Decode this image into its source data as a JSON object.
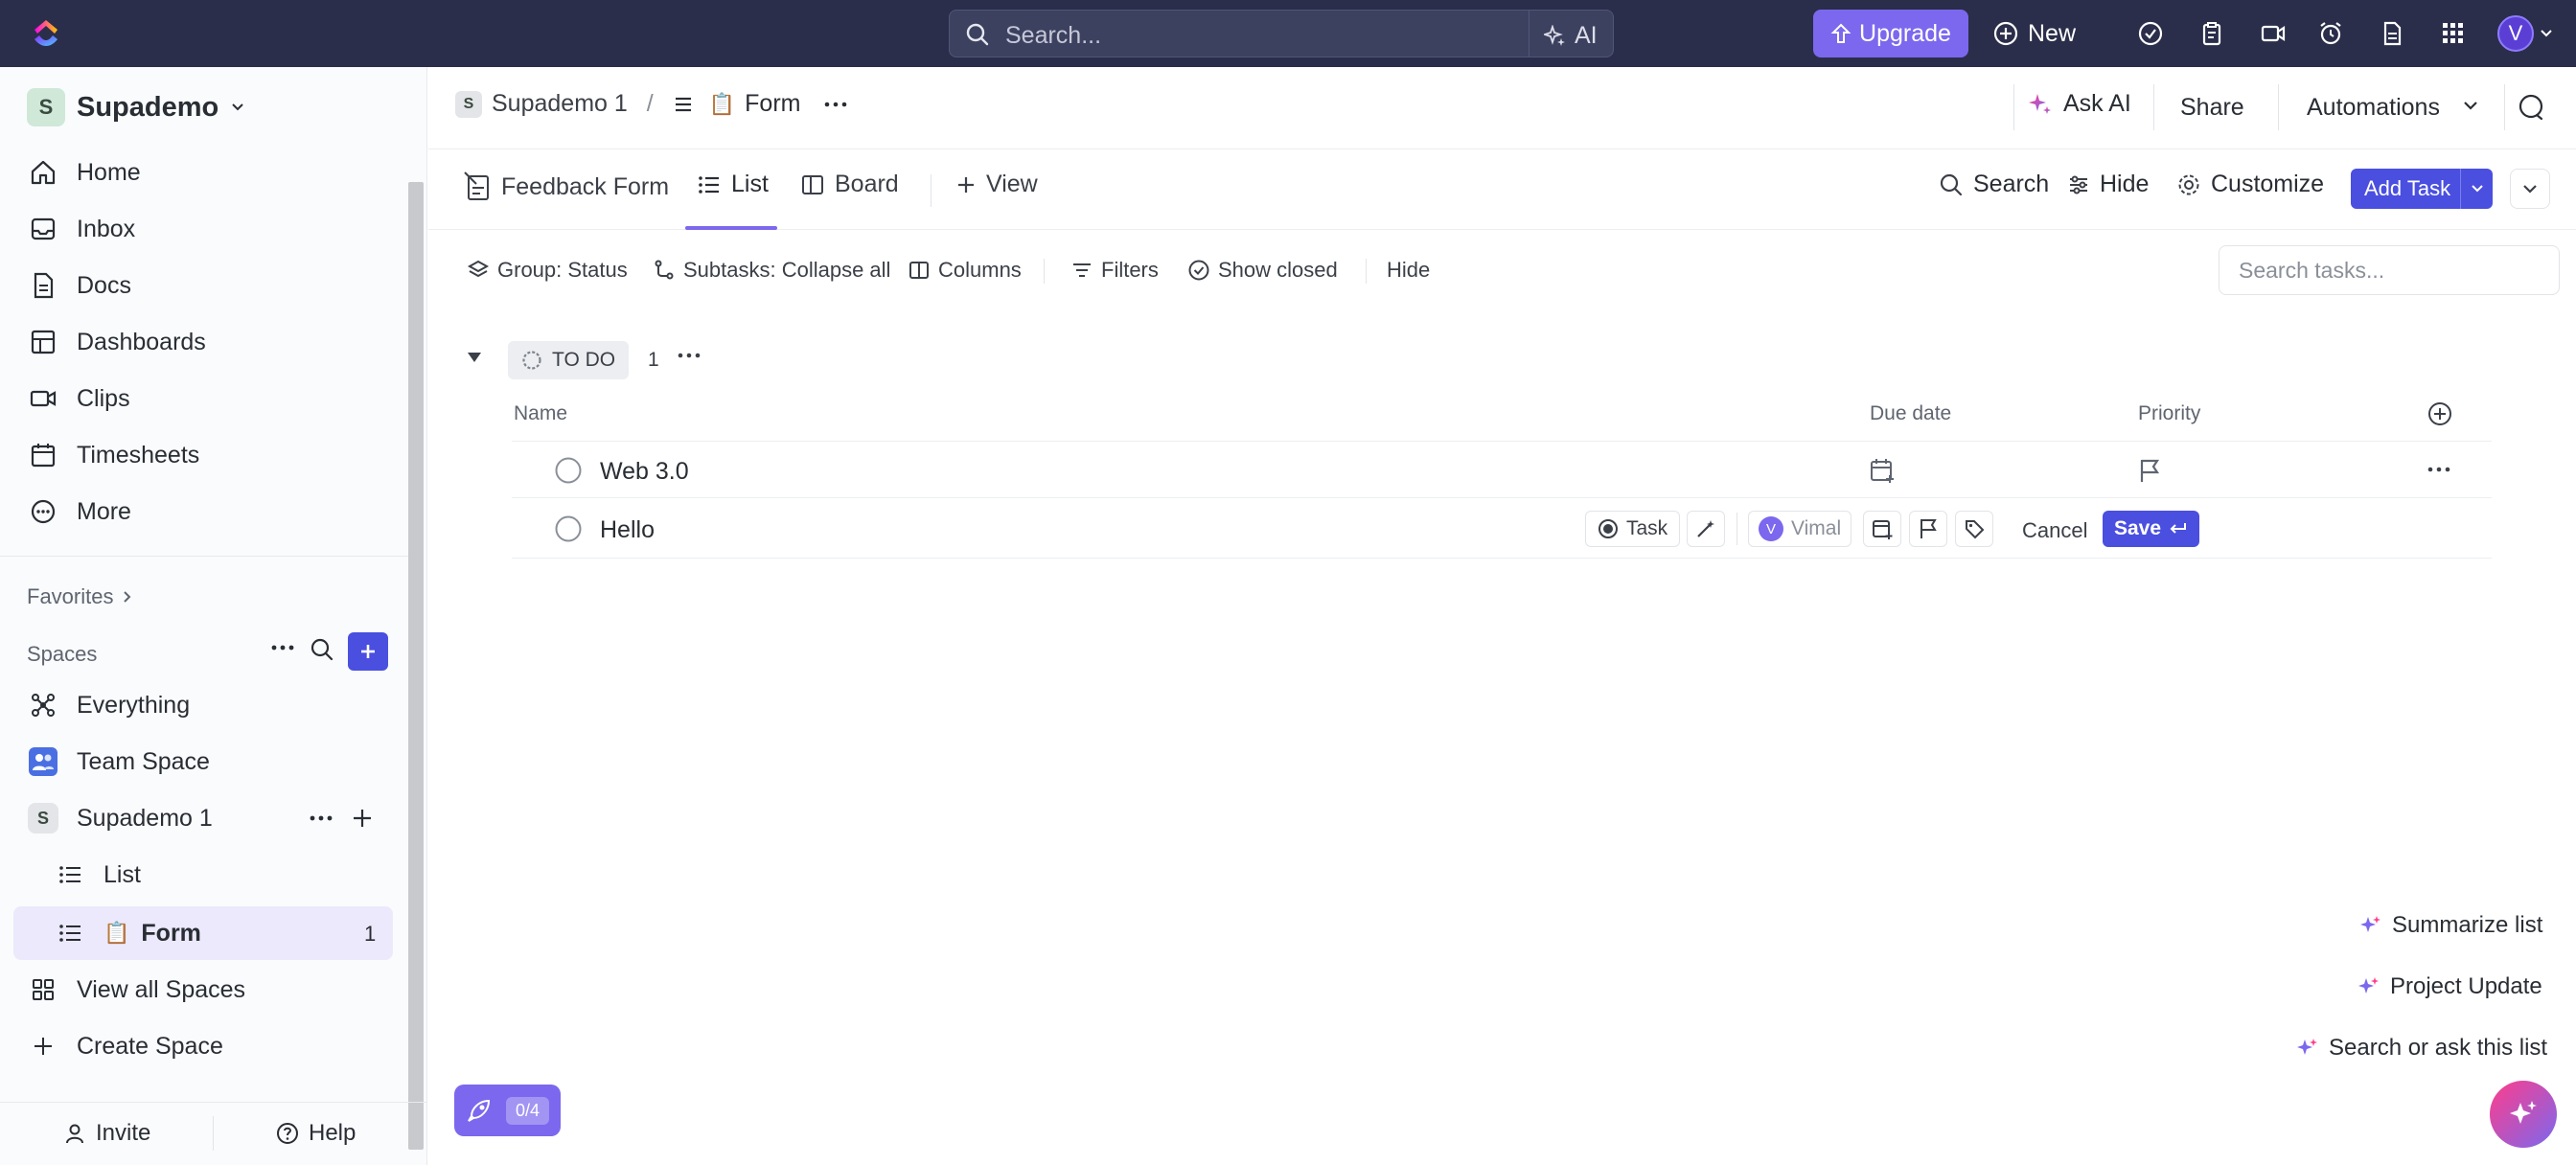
{
  "topbar": {
    "search_placeholder": "Search...",
    "ai_label": "AI",
    "upgrade_label": "Upgrade",
    "new_label": "New",
    "avatar_initial": "V"
  },
  "sidebar": {
    "workspace_initial": "S",
    "workspace_name": "Supademo",
    "nav": [
      "Home",
      "Inbox",
      "Docs",
      "Dashboards",
      "Clips",
      "Timesheets",
      "More"
    ],
    "favorites_label": "Favorites",
    "spaces_label": "Spaces",
    "spaces": {
      "everything": "Everything",
      "team_space": "Team Space",
      "supademo1_initial": "S",
      "supademo1": "Supademo 1",
      "list": "List",
      "form_emoji": "📋",
      "form": "Form",
      "form_count": "1",
      "view_all": "View all Spaces",
      "create": "Create Space"
    },
    "invite_label": "Invite",
    "help_label": "Help"
  },
  "breadcrumb": {
    "space_initial": "S",
    "space": "Supademo 1",
    "separator": "/",
    "list_emoji": "📋",
    "list": "Form",
    "ask_ai": "Ask AI",
    "share": "Share",
    "automations": "Automations"
  },
  "views": {
    "feedback_form": "Feedback Form",
    "list": "List",
    "board": "Board",
    "add_view": "View",
    "search": "Search",
    "hide": "Hide",
    "customize": "Customize",
    "add_task": "Add Task"
  },
  "filters": {
    "group": "Group: Status",
    "subtasks": "Subtasks: Collapse all",
    "columns": "Columns",
    "filters": "Filters",
    "show_closed": "Show closed",
    "hide": "Hide",
    "search_placeholder": "Search tasks..."
  },
  "group": {
    "status": "TO DO",
    "count": "1",
    "columns": {
      "name": "Name",
      "due_date": "Due date",
      "priority": "Priority"
    }
  },
  "tasks": [
    {
      "name": "Web 3.0"
    }
  ],
  "new_task": {
    "value": "Hello",
    "type_label": "Task",
    "assignee_initial": "V",
    "assignee": "Vimal",
    "cancel": "Cancel",
    "save": "Save"
  },
  "ai_actions": {
    "summarize": "Summarize list",
    "project_update": "Project Update",
    "search_ask": "Search or ask this list"
  },
  "onboarding": {
    "progress": "0/4"
  },
  "colors": {
    "accent": "#7b68ee",
    "primary_button": "#4a4fe0",
    "topbar": "#2a2e4a"
  }
}
